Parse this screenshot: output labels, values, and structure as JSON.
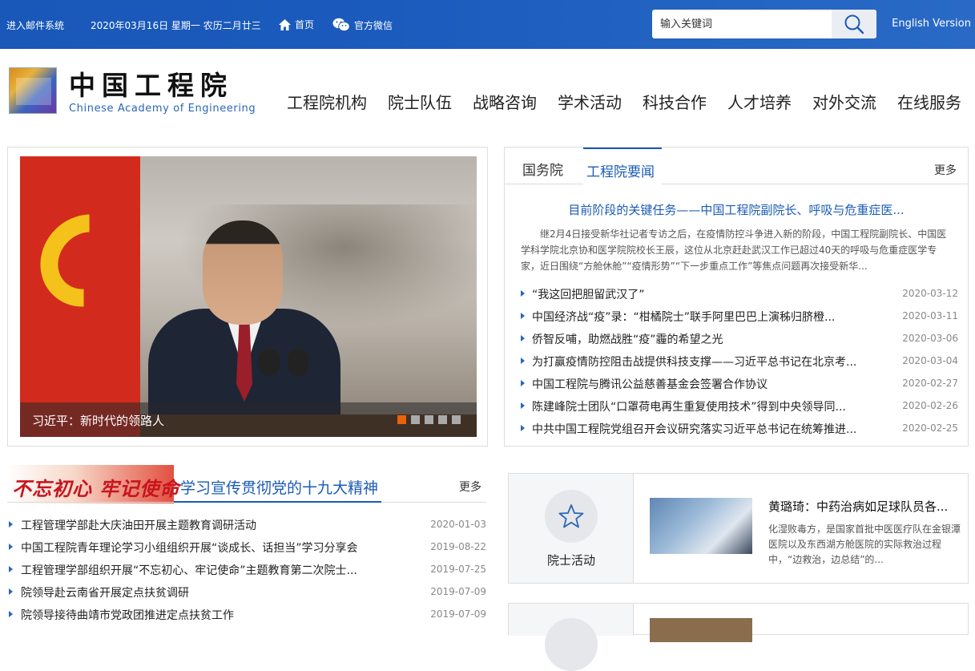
{
  "topbar": {
    "mail": "进入邮件系统",
    "date": "2020年03月16日  星期一  农历二月廿三",
    "home": "首页",
    "wechat": "官方微信",
    "search_placeholder": "输入关键词",
    "english": "English Version"
  },
  "logo": {
    "cn": "中国工程院",
    "en": "Chinese Academy of Engineering"
  },
  "nav": [
    "工程院机构",
    "院士队伍",
    "战略咨询",
    "学术活动",
    "科技合作",
    "人才培养",
    "对外交流",
    "在线服务"
  ],
  "carousel": {
    "caption": "习近平：新时代的领路人",
    "dots": 5,
    "active_dot": 0
  },
  "news": {
    "tabs": [
      "国务院",
      "工程院要闻"
    ],
    "active_tab": 1,
    "more": "更多",
    "headline": "目前阶段的关键任务——中国工程院副院长、呼吸与危重症医...",
    "summary": "继2月4日接受新华社记者专访之后，在疫情防控斗争进入新的阶段，中国工程院副院长、中国医学科学院北京协和医学院院校长王辰，这位从北京赶赴武汉工作已超过40天的呼吸与危重症医学专家，近日围绕“方舱休舱”“疫情形势”“下一步重点工作”等焦点问题再次接受新华...",
    "items": [
      {
        "title": "“我这回把胆留武汉了”",
        "date": "2020-03-12"
      },
      {
        "title": "中国经济战“疫”录：“柑橘院士”联手阿里巴巴上演秭归脐橙...",
        "date": "2020-03-11"
      },
      {
        "title": "侨智反哺，助燃战胜“疫”霾的希望之光",
        "date": "2020-03-06"
      },
      {
        "title": "为打赢疫情防控阻击战提供科技支撑——习近平总书记在北京考...",
        "date": "2020-03-04"
      },
      {
        "title": "中国工程院与腾讯公益慈善基金会签署合作协议",
        "date": "2020-02-27"
      },
      {
        "title": "陈建峰院士团队“口罩荷电再生重复使用技术”得到中央领导同...",
        "date": "2020-02-26"
      },
      {
        "title": "中共中国工程院党组召开会议研究落实习近平总书记在统筹推进...",
        "date": "2020-02-25"
      }
    ]
  },
  "study": {
    "banner": "不忘初心 牢记使命",
    "title": "学习宣传贯彻党的十九大精神",
    "more": "更多",
    "items": [
      {
        "title": "工程管理学部赴大庆油田开展主题教育调研活动",
        "date": "2020-01-03"
      },
      {
        "title": "中国工程院青年理论学习小组组织开展“谈成长、话担当”学习分享会",
        "date": "2019-08-22"
      },
      {
        "title": "工程管理学部组织开展“不忘初心、牢记使命”主题教育第二次院士...",
        "date": "2019-07-25"
      },
      {
        "title": "院领导赴云南省开展定点扶贫调研",
        "date": "2019-07-09"
      },
      {
        "title": "院领导接待曲靖市党政团推进定点扶贫工作",
        "date": "2019-07-09"
      }
    ]
  },
  "academician": {
    "label": "院士活动",
    "title": "黄璐琦：中药治病如足球队员各...",
    "desc": "化湿败毒方，是国家首批中医医疗队在金银潭医院以及东西湖方舱医院的实际救治过程中，“边救治，边总结”的..."
  }
}
